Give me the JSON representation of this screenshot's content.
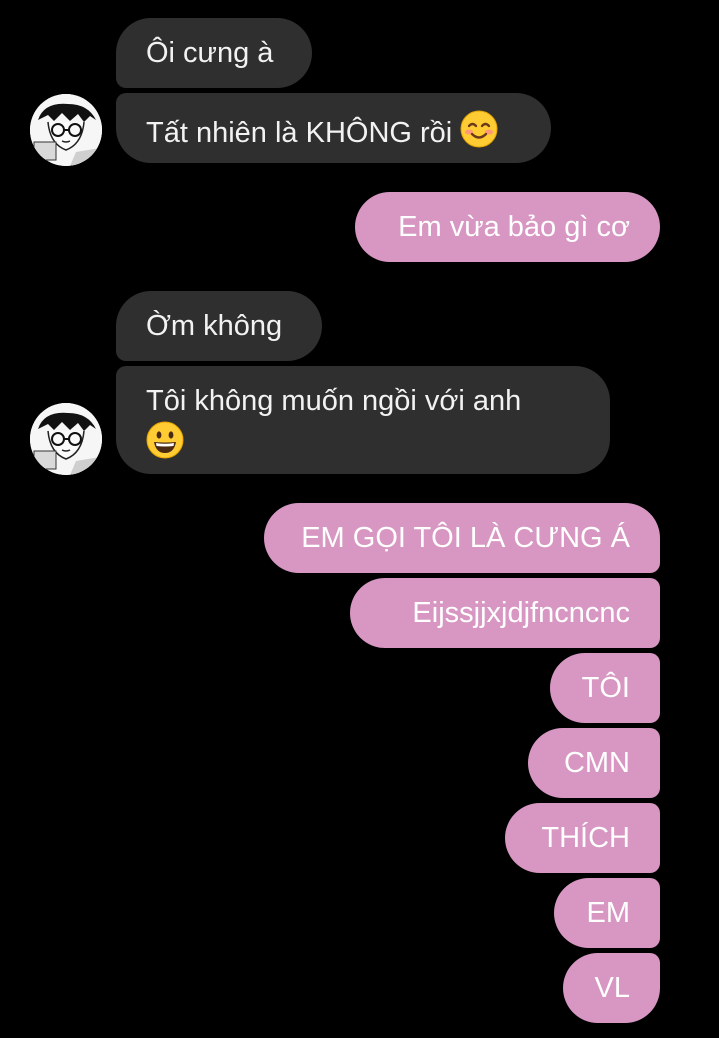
{
  "messages": {
    "in1": "Ôi cưng à",
    "in2_text": "Tất nhiên là KHÔNG rồi",
    "in2_emoji": "smiling-face-with-smiling-eyes",
    "out1": "Em vừa bảo gì cơ",
    "in3": "Ờm không",
    "in4_text": "Tôi không muốn ngồi với anh",
    "in4_emoji": "grinning-face",
    "out2": "EM GỌI TÔI LÀ CƯNG Á",
    "out3": "Eijssjjxjdjfncncnc",
    "out4": "TÔI",
    "out5": "CMN",
    "out6": "THÍCH",
    "out7": "EM",
    "out8": "VL"
  },
  "colors": {
    "background": "#000000",
    "incoming_bubble": "#2f2f2f",
    "outgoing_bubble": "#d797c2"
  },
  "icons": {
    "avatar": "manga-character-avatar"
  }
}
